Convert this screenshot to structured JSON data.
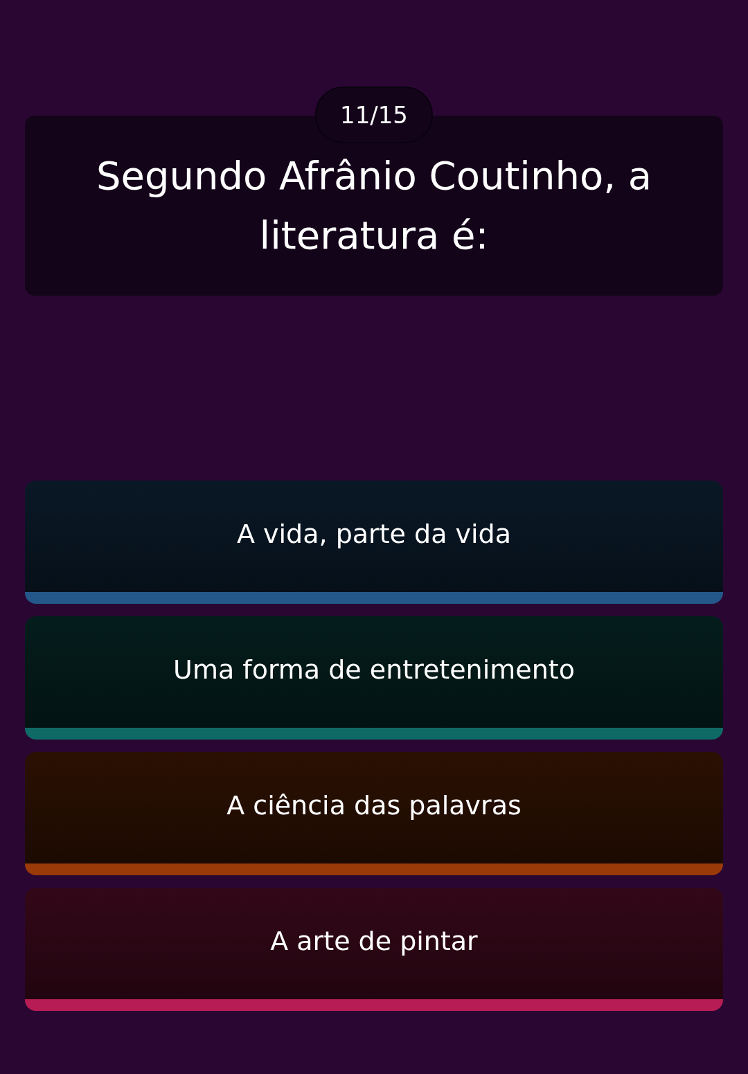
{
  "progress": "11/15",
  "question": "Segundo Afrânio Coutinho, a literatura é:",
  "options": [
    {
      "text": "A vida, parte da vida",
      "color": "#24588a"
    },
    {
      "text": "Uma forma de entretenimento",
      "color": "#0f6a66"
    },
    {
      "text": "A ciência das palavras",
      "color": "#9a3a08"
    },
    {
      "text": "A arte de pintar",
      "color": "#b81c55"
    }
  ]
}
